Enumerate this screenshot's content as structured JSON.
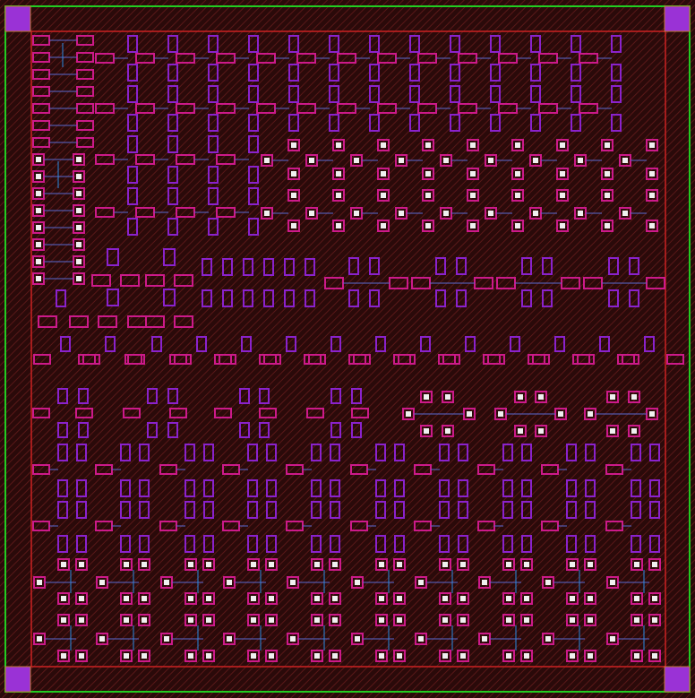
{
  "colors": {
    "background": "#2a0a0a",
    "hatch": "#5a1818",
    "outer_border": "#22cc22",
    "core_border": "#cc2222",
    "corner_pad": "#9a32d6",
    "corner_inner": "#c07a30",
    "poly": "#cc1a8a",
    "diffusion": "#8a22cc",
    "contact_outer": "#cc1a8a",
    "contact_fill": "#f0f0f0",
    "metal": "#2a8ae0",
    "metal_dim": "#5a6ad0"
  },
  "layers": [
    "outer-boundary",
    "core-boundary",
    "corner-pads",
    "poly",
    "diffusion",
    "contacts",
    "metal"
  ]
}
